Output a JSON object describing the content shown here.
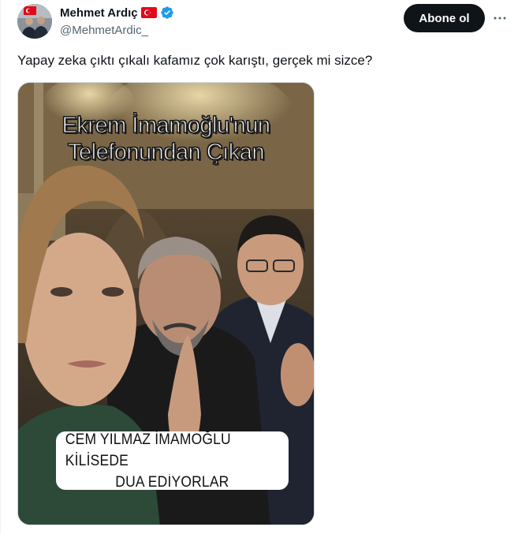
{
  "author": {
    "name": "Mehmet Ardıç",
    "handle": "@MehmetArdic_"
  },
  "follow_label": "Abone ol",
  "tweet_text": "Yapay zeka çıktı çıkalı kafamız çok karıştı, gerçek mi sizce?",
  "media": {
    "overlay_title_line1": "Ekrem İmamoğlu'nun",
    "overlay_title_line2": "Telefonundan Çıkan",
    "caption_line1": "CEM YILMAZ İMAMOĞLU KİLİSEDE",
    "caption_line2": "DUA EDİYORLAR"
  },
  "icons": {
    "flag": "turkey-flag-icon",
    "verified": "verified-badge-icon",
    "more": "more-options-icon"
  },
  "colors": {
    "follow_button_bg": "#0f1419",
    "verified_blue": "#1d9bf0",
    "handle_gray": "#536471",
    "flag_red": "#e30a17"
  }
}
